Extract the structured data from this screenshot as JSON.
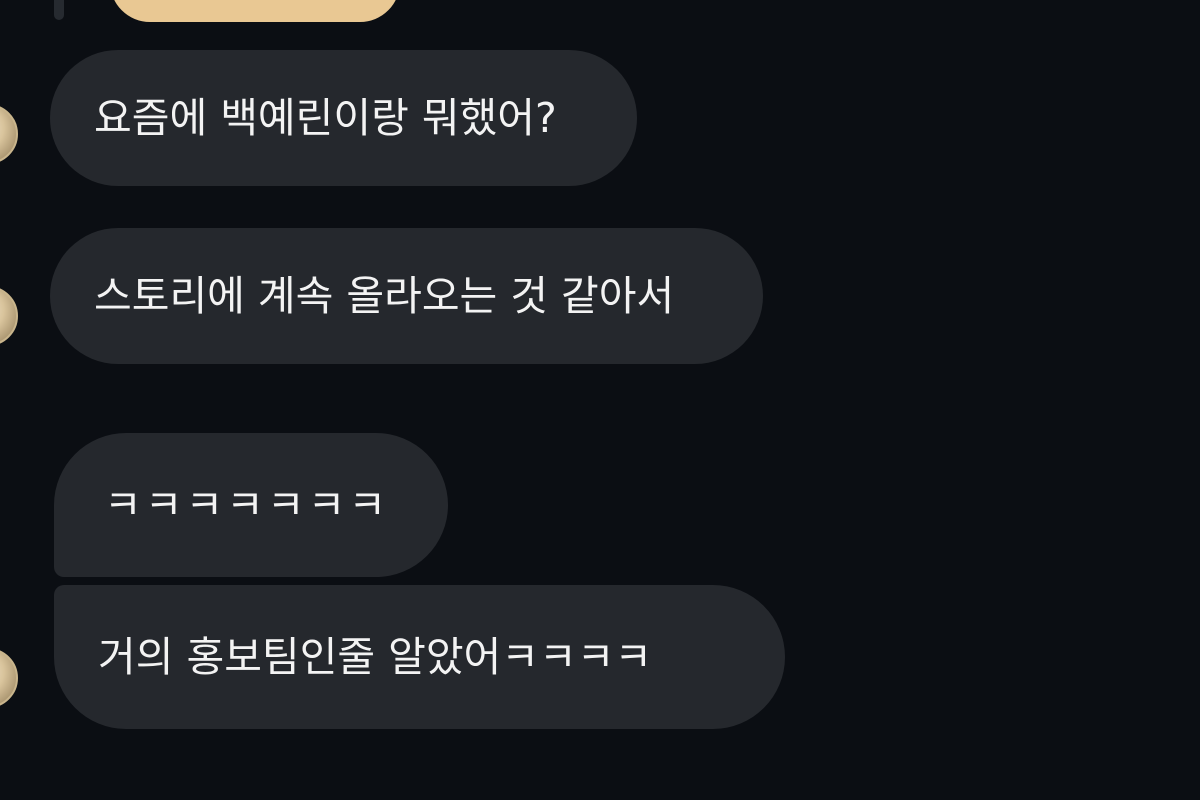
{
  "messages": [
    {
      "text": "요즘에 백예린이랑 뭐했어?"
    },
    {
      "text": "스토리에 계속 올라오는 것 같아서"
    },
    {
      "text": "ㅋㅋㅋㅋㅋㅋㅋ"
    },
    {
      "text": "거의 홍보팀인줄 알았어ㅋㅋㅋㅋ"
    }
  ],
  "colors": {
    "background": "#0b0e13",
    "bubble": "#25282d",
    "text": "#f3f3f3",
    "sent_bubble": "#e9c893"
  }
}
